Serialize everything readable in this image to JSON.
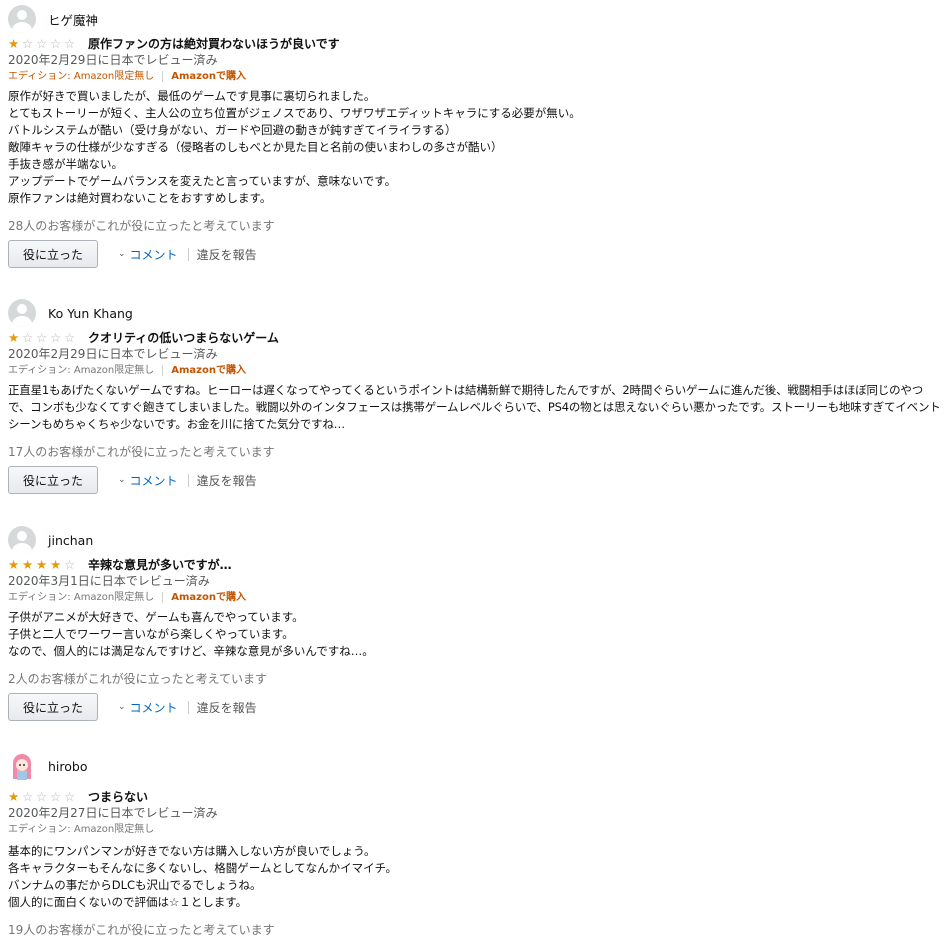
{
  "reviews": [
    {
      "author": "ヒゲ魔神",
      "avatar": "default-avatar",
      "rating": 1,
      "title": "原作ファンの方は絶対買わないほうが良いです",
      "date": "2020年2月29日に日本でレビュー済み",
      "edition": "エディション: Amazon限定無し",
      "purchase": "Amazonで購入",
      "body": [
        "原作が好きで買いましたが、最低のゲームです見事に裏切られました。",
        "とてもストーリーが短く、主人公の立ち位置がジェノスであり、ワザワザエディットキャラにする必要が無い。",
        "バトルシステムが酷い（受け身がない、ガードや回避の動きが鈍すぎてイライラする）",
        "敵陣キャラの仕様が少なすぎる（侵略者のしもべとか見た目と名前の使いまわしの多さが酷い）",
        "手抜き感が半端ない。",
        "アップデートでゲームバランスを変えたと言っていますが、意味ないです。",
        "原作ファンは絶対買わないことをおすすめします。"
      ],
      "helpful": "28人のお客様がこれが役に立ったと考えています",
      "helpful_button": "役に立った",
      "comment": "コメント",
      "report": "違反を報告"
    },
    {
      "author": "Ko Yun Khang",
      "avatar": "default-avatar",
      "rating": 1,
      "title": "クオリティの低いつまらないゲーム",
      "date": "2020年2月29日に日本でレビュー済み",
      "edition": "エディション: Amazon限定無し",
      "purchase": "Amazonで購入",
      "body": [
        "正直星1もあげたくないゲームですね。ヒーローは遅くなってやってくるというポイントは結構新鮮で期待したんですが、2時間ぐらいゲームに進んだ後、戦闘相手はほぼ同じのやつで、コンボも少なくてすぐ飽きてしまいました。戦闘以外のインタフェースは携帯ゲームレベルぐらいで、PS4の物とは思えないぐらい悪かったです。ストーリーも地味すぎてイベントシーンもめちゃくちゃ少ないです。お金を川に捨てた気分ですね…"
      ],
      "helpful": "17人のお客様がこれが役に立ったと考えています",
      "helpful_button": "役に立った",
      "comment": "コメント",
      "report": "違反を報告"
    },
    {
      "author": "jinchan",
      "avatar": "default-avatar",
      "rating": 4,
      "title": "辛辣な意見が多いですが…",
      "date": "2020年3月1日に日本でレビュー済み",
      "edition": "エディション: Amazon限定無し",
      "purchase": "Amazonで購入",
      "body": [
        "子供がアニメが大好きで、ゲームも喜んでやっています。",
        "子供と二人でワーワー言いながら楽しくやっています。",
        "なので、個人的には満足なんですけど、辛辣な意見が多いんですね…。"
      ],
      "helpful": "2人のお客様がこれが役に立ったと考えています",
      "helpful_button": "役に立った",
      "comment": "コメント",
      "report": "違反を報告"
    },
    {
      "author": "hirobo",
      "avatar": "custom-anime-avatar",
      "rating": 1,
      "title": "つまらない",
      "date": "2020年2月27日に日本でレビュー済み",
      "edition": "エディション: Amazon限定無し",
      "body": [
        "基本的にワンパンマンが好きでない方は購入しない方が良いでしょう。",
        "各キャラクターもそんなに多くないし、格闘ゲームとしてなんかイマイチ。",
        "バンナムの事だからDLCも沢山でるでしょうね。",
        "個人的に面白くないので評価は☆１とします。"
      ],
      "helpful": "19人のお客様がこれが役に立ったと考えています"
    }
  ],
  "colors": {
    "star_filled": "#e69a00",
    "star_empty": "#b8b8b8",
    "link_orange": "#c45500",
    "link_blue": "#0066c0"
  }
}
